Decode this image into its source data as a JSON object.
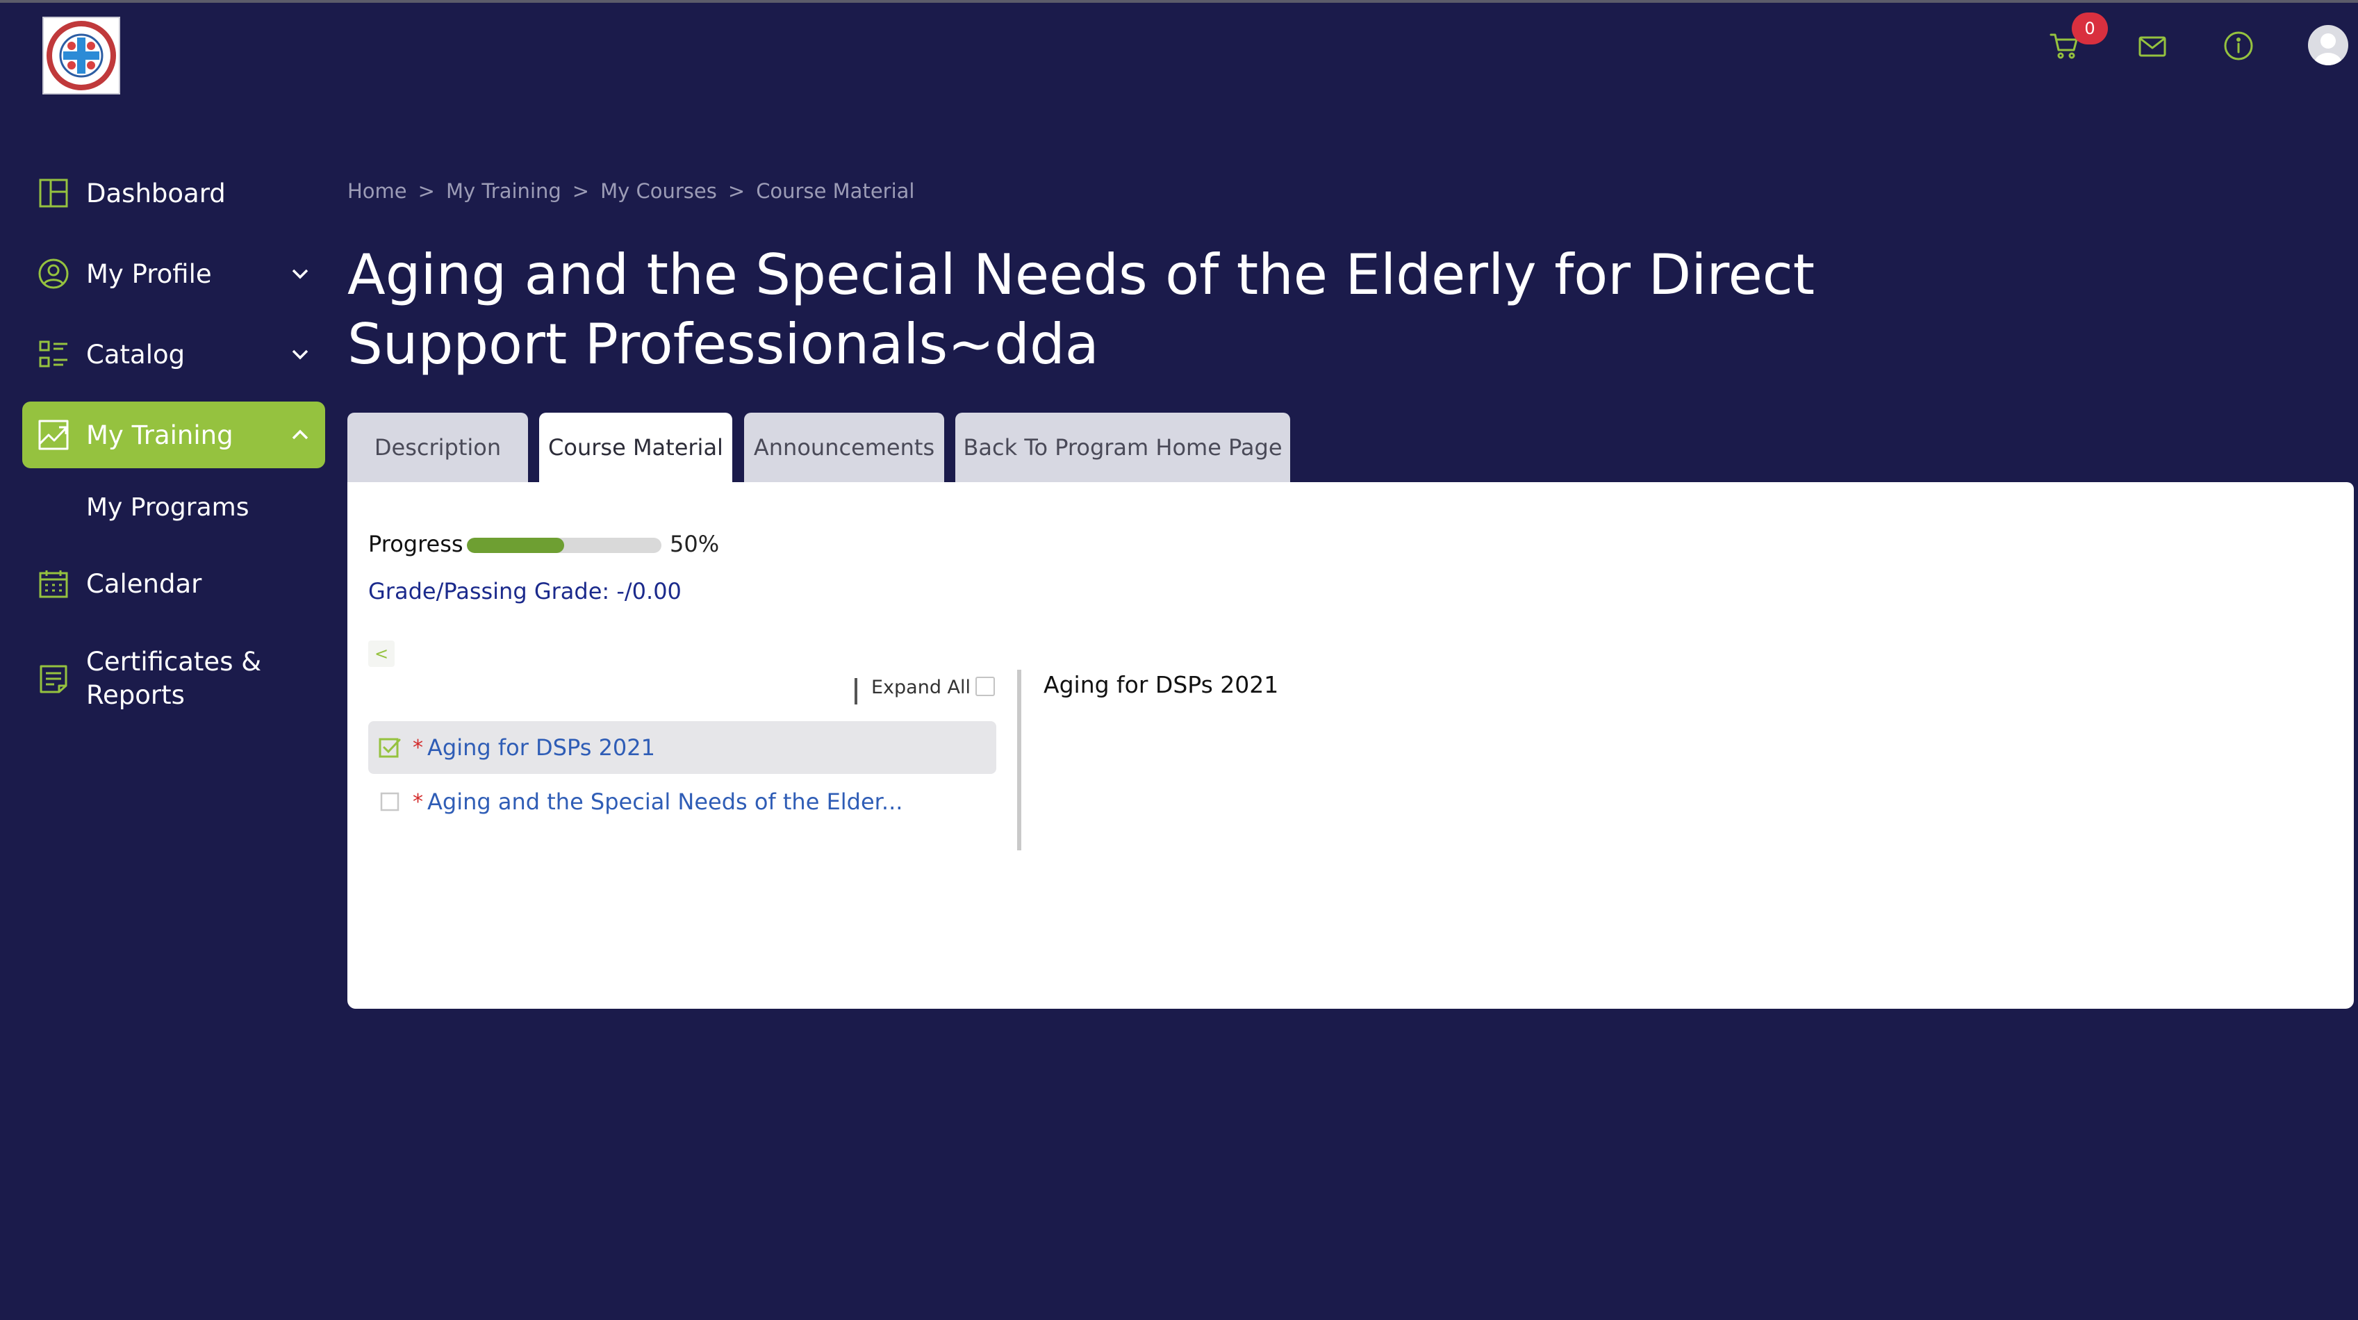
{
  "header": {
    "logo_name": "organization-logo",
    "cart_count": "0",
    "icons": [
      "cart-icon",
      "mail-icon",
      "info-icon",
      "avatar"
    ]
  },
  "sidebar": {
    "items": [
      {
        "label": "Dashboard",
        "icon": "dashboard-icon"
      },
      {
        "label": "My Profile",
        "icon": "profile-icon",
        "expandable": true
      },
      {
        "label": "Catalog",
        "icon": "catalog-icon",
        "expandable": true
      },
      {
        "label": "My Training",
        "icon": "training-icon",
        "expandable": true,
        "active": true
      },
      {
        "label": "My Programs",
        "sub": true
      },
      {
        "label": "Calendar",
        "icon": "calendar-icon"
      },
      {
        "label": "Certificates & Reports",
        "line1": "Certificates &",
        "line2": "Reports",
        "icon": "certificate-icon"
      }
    ]
  },
  "breadcrumb": {
    "items": [
      "Home",
      "My Training",
      "My Courses",
      "Course Material"
    ],
    "separator": ">"
  },
  "page": {
    "title": "Aging and the Special Needs of the Elderly for Direct Support Professionals~dda"
  },
  "tabs": [
    {
      "label": "Description",
      "active": false
    },
    {
      "label": "Course Material",
      "active": true
    },
    {
      "label": "Announcements",
      "active": false
    },
    {
      "label": "Back To Program Home Page",
      "active": false
    }
  ],
  "course_material": {
    "progress_label": "Progress",
    "progress_percent": 50,
    "progress_text": "50%",
    "grade_text": "Grade/Passing Grade: -/0.00",
    "collapse_label": "<",
    "expand_all_label": "Expand All",
    "items": [
      {
        "title": "Aging for DSPs 2021",
        "required": true,
        "checked": true,
        "selected": true
      },
      {
        "title": "Aging and the Special Needs of the Elder...",
        "required": true,
        "checked": false,
        "selected": false
      }
    ],
    "required_marker": "*",
    "detail_title": "Aging for DSPs 2021"
  },
  "colors": {
    "background": "#1b1b4b",
    "accent": "#95c23f",
    "progress_fill": "#6e9f32",
    "link": "#2f5db6",
    "grade_text": "#1b2a8c",
    "badge": "#d9303f",
    "required_star": "#d32c2c"
  }
}
